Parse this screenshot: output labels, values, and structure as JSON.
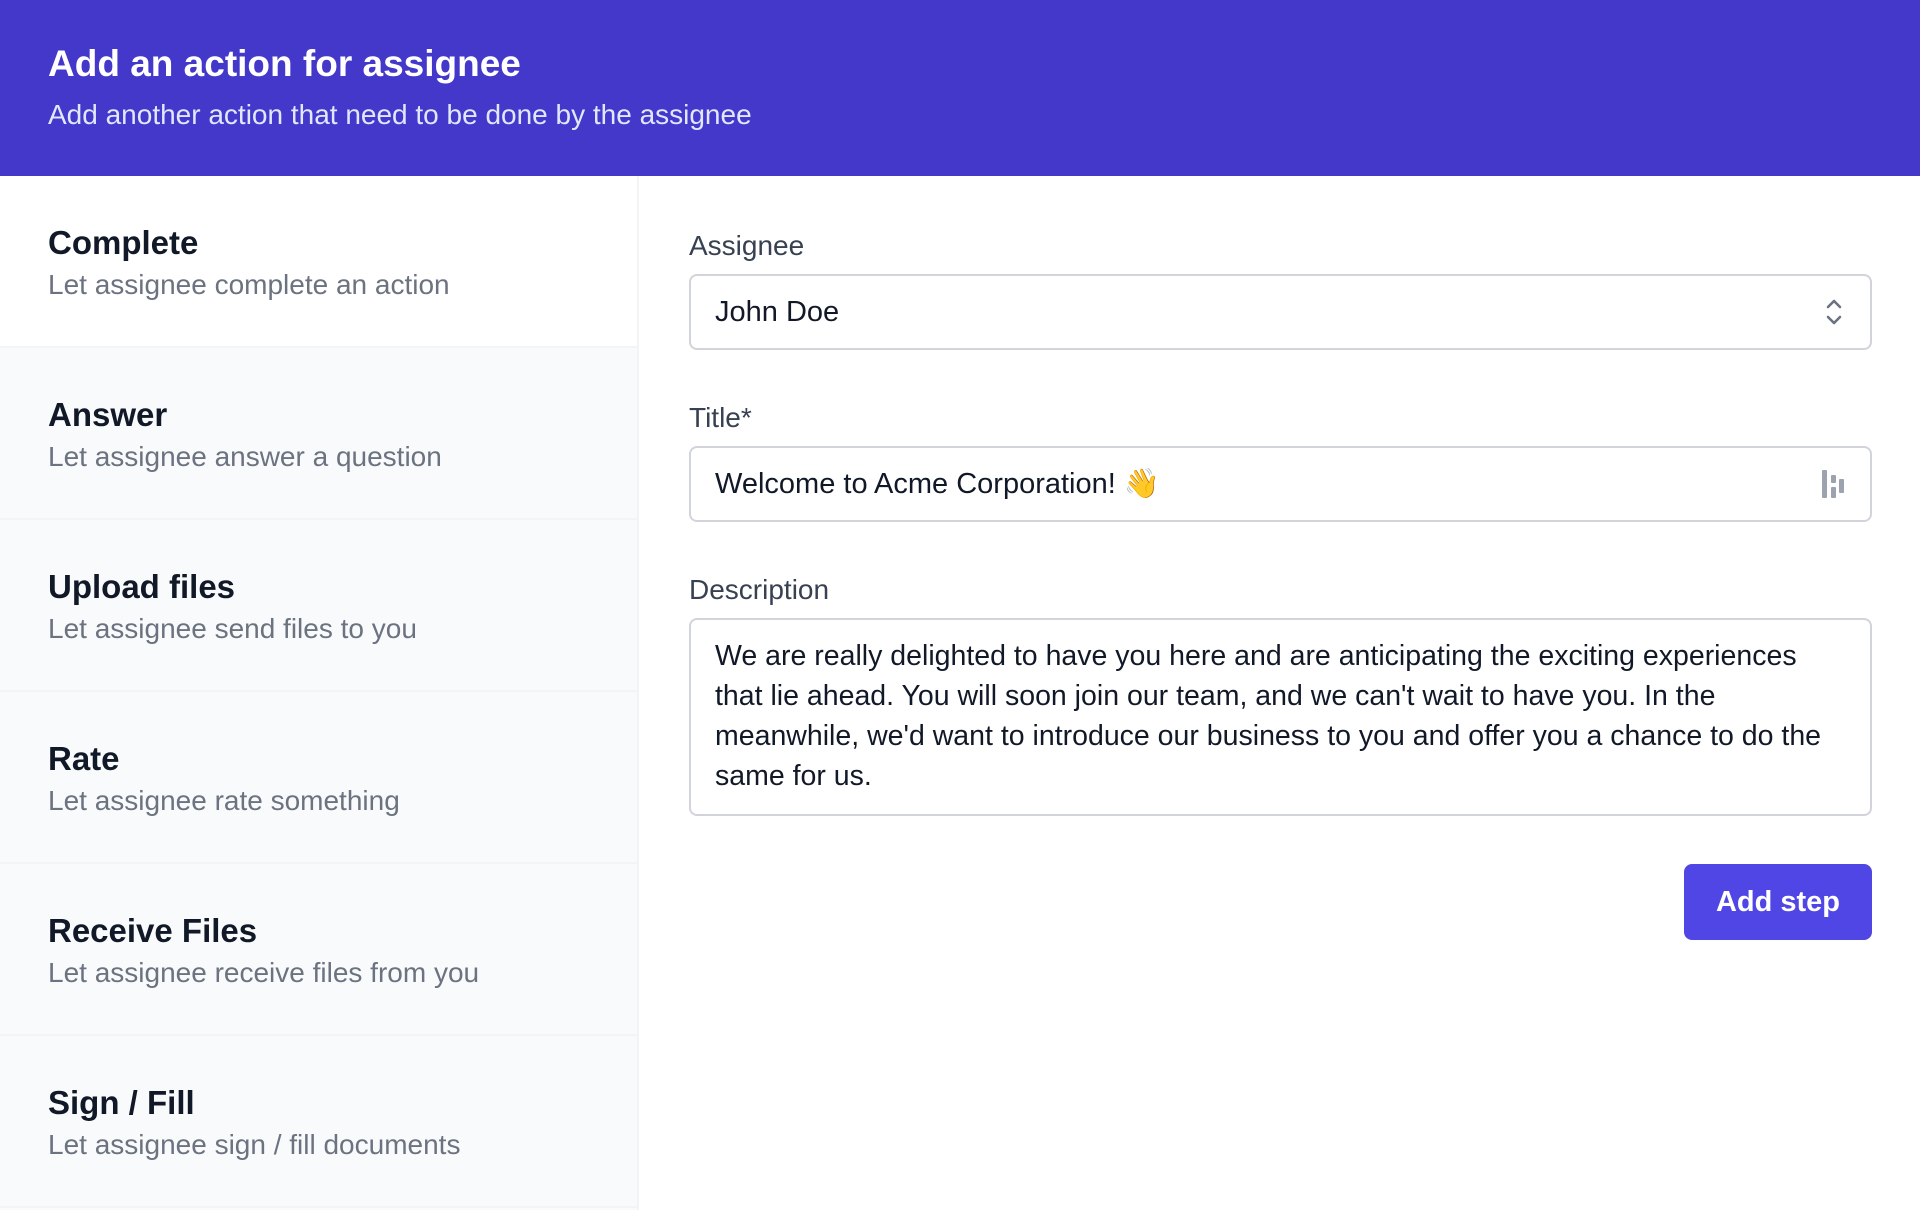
{
  "header": {
    "title": "Add an action for assignee",
    "subtitle": "Add another action that need to be done by the assignee"
  },
  "actions": [
    {
      "title": "Complete",
      "description": "Let assignee complete an action"
    },
    {
      "title": "Answer",
      "description": "Let assignee answer a question"
    },
    {
      "title": "Upload files",
      "description": "Let assignee send files to you"
    },
    {
      "title": "Rate",
      "description": "Let assignee rate something"
    },
    {
      "title": "Receive Files",
      "description": "Let assignee receive files from you"
    },
    {
      "title": "Sign / Fill",
      "description": "Let assignee sign / fill documents"
    }
  ],
  "form": {
    "assignee_label": "Assignee",
    "assignee_value": "John Doe",
    "title_label": "Title*",
    "title_value": "Welcome to Acme Corporation! 👋",
    "description_label": "Description",
    "description_value": "We are really delighted to have you here and are anticipating the exciting experiences that lie ahead. You will soon join our team, and we can't wait to have you. In the meanwhile, we'd want to introduce our business to you and offer you a chance to do the same for us.",
    "submit_label": "Add step"
  },
  "colors": {
    "header_bg": "#4338ca",
    "button_bg": "#4f46e5"
  },
  "icons": {
    "select": "chevron-up-down-icon",
    "title_input": "variable-slot-icon"
  }
}
